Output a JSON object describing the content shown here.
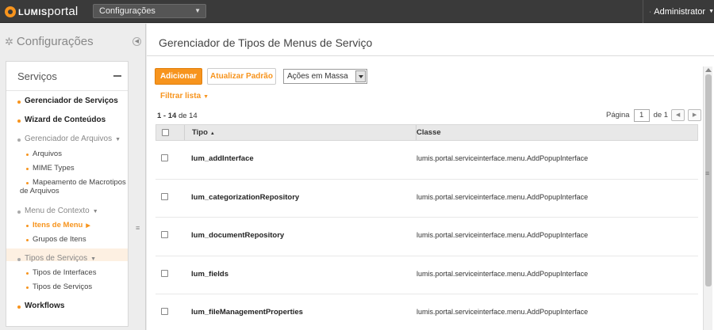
{
  "topbar": {
    "logo_prefix": "LUMIS",
    "logo_suffix": "portal",
    "context_select": "Configurações",
    "user": "Administrator"
  },
  "sidebar": {
    "title": "Configurações",
    "panel_title": "Serviços",
    "items": [
      {
        "label": "Gerenciador de Serviços"
      },
      {
        "label": "Wizard de Conteúdos"
      },
      {
        "label": "Gerenciador de Arquivos"
      },
      {
        "label": "Arquivos"
      },
      {
        "label": "MIME Types"
      },
      {
        "label": "Mapeamento de Macrotipos"
      },
      {
        "label": "de Arquivos"
      },
      {
        "label": "Menu de Contexto"
      },
      {
        "label": "Itens de Menu"
      },
      {
        "label": "Grupos de Itens"
      },
      {
        "label": "Tipos de Serviços"
      },
      {
        "label": "Tipos de Interfaces"
      },
      {
        "label": "Tipos de Serviços"
      },
      {
        "label": "Workflows"
      }
    ]
  },
  "main": {
    "title": "Gerenciador de Tipos de Menus de Serviço",
    "add_label": "Adicionar",
    "reset_label": "Atualizar Padrão",
    "mass_actions": "Ações em Massa",
    "filter_label": "Filtrar lista",
    "count_range": "1 - 14",
    "count_of": "de 14",
    "page_label": "Página",
    "page_value": "1",
    "page_total": "de 1",
    "columns": {
      "tipo": "Tipo",
      "classe": "Classe"
    },
    "rows": [
      {
        "tipo": "lum_addInterface",
        "classe": "lumis.portal.serviceinterface.menu.AddPopupInterface"
      },
      {
        "tipo": "lum_categorizationRepository",
        "classe": "lumis.portal.serviceinterface.menu.AddPopupInterface"
      },
      {
        "tipo": "lum_documentRepository",
        "classe": "lumis.portal.serviceinterface.menu.AddPopupInterface"
      },
      {
        "tipo": "lum_fields",
        "classe": "lumis.portal.serviceinterface.menu.AddPopupInterface"
      },
      {
        "tipo": "lum_fileManagementProperties",
        "classe": "lumis.portal.serviceinterface.menu.AddPopupInterface"
      }
    ]
  }
}
